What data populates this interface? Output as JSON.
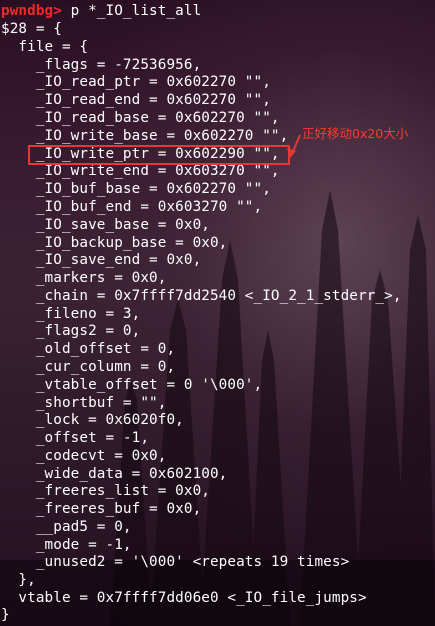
{
  "terminal": {
    "prompt": {
      "name": "pwndbg>",
      "command": " p *_IO_list_all"
    },
    "lines": [
      "$28 = {",
      "  file = {",
      "    _flags = -72536956,",
      "    _IO_read_ptr = 0x602270 \"\",",
      "    _IO_read_end = 0x602270 \"\",",
      "    _IO_read_base = 0x602270 \"\",",
      "    _IO_write_base = 0x602270 \"\",",
      "    _IO_write_ptr = 0x602290 \"\",",
      "    _IO_write_end = 0x603270 \"\",",
      "    _IO_buf_base = 0x602270 \"\",",
      "    _IO_buf_end = 0x603270 \"\",",
      "    _IO_save_base = 0x0,",
      "    _IO_backup_base = 0x0,",
      "    _IO_save_end = 0x0,",
      "    _markers = 0x0,",
      "    _chain = 0x7ffff7dd2540 <_IO_2_1_stderr_>,",
      "    _fileno = 3,",
      "    _flags2 = 0,",
      "    _old_offset = 0,",
      "    _cur_column = 0,",
      "    _vtable_offset = 0 '\\000',",
      "    _shortbuf = \"\",",
      "    _lock = 0x6020f0,",
      "    _offset = -1,",
      "    _codecvt = 0x0,",
      "    _wide_data = 0x602100,",
      "    _freeres_list = 0x0,",
      "    _freeres_buf = 0x0,",
      "    __pad5 = 0,",
      "    _mode = -1,",
      "    _unused2 = '\\000' <repeats 19 times>",
      "  },",
      "  vtable = 0x7ffff7dd06e0 <_IO_file_jumps>",
      "}"
    ]
  },
  "annotation": {
    "text": "正好移动0x20大小",
    "color": "#ff3b30"
  },
  "colors": {
    "prompt": "#ef2929",
    "text": "#ffffff",
    "background": "#2f1a2a"
  }
}
